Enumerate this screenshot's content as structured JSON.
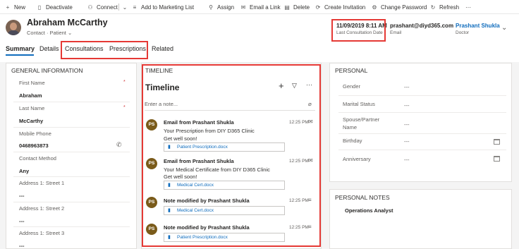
{
  "command_bar": {
    "items": [
      {
        "label": "New",
        "icon": "plus-icon"
      },
      {
        "label": "Deactivate",
        "icon": "deactivate-icon"
      },
      {
        "label": "Connect",
        "icon": "connect-icon"
      },
      {
        "label": "Add to Marketing List",
        "icon": "add-list-icon"
      },
      {
        "label": "Assign",
        "icon": "assign-icon"
      },
      {
        "label": "Email a Link",
        "icon": "email-icon"
      },
      {
        "label": "Delete",
        "icon": "trash-icon"
      },
      {
        "label": "Create Invitation",
        "icon": "invitation-icon"
      },
      {
        "label": "Change Password",
        "icon": "password-icon"
      },
      {
        "label": "Refresh",
        "icon": "refresh-icon"
      }
    ],
    "more": "···"
  },
  "record": {
    "name": "Abraham McCarthy",
    "entity": "Contact",
    "form": "Patient",
    "header_fields": [
      {
        "value": "11/09/2019 8:11 AM",
        "label": "Last Consultation Date"
      },
      {
        "value": "prashant@diyd365.com",
        "label": "Email"
      },
      {
        "value": "Prashant Shukla",
        "label": "Doctor"
      }
    ]
  },
  "tabs": [
    "Summary",
    "Details",
    "Consultations",
    "Prescriptions",
    "Related"
  ],
  "general": {
    "section_title": "GENERAL INFORMATION",
    "fields": [
      {
        "label": "First Name",
        "value": "Abraham",
        "required": "*"
      },
      {
        "label": "Last Name",
        "value": "McCarthy",
        "required": "*"
      },
      {
        "label": "Mobile Phone",
        "value": "0468963873"
      },
      {
        "label": "Contact Method",
        "value": "Any"
      },
      {
        "label": "Address 1: Street 1",
        "value": "---"
      },
      {
        "label": "Address 1: Street 2",
        "value": "---"
      },
      {
        "label": "Address 1: Street 3",
        "value": "---"
      }
    ]
  },
  "timeline": {
    "section_title": "TIMELINE",
    "heading": "Timeline",
    "note_placeholder": "Enter a note...",
    "initials": "PS",
    "items": [
      {
        "title": "Email from Prashant Shukla",
        "lines": [
          "Your Prescription from DIY D365 Clinic",
          "Get well soon!"
        ],
        "time": "12:25 PM",
        "attachment": "Patient Prescription.docx"
      },
      {
        "title": "Email from Prashant Shukla",
        "lines": [
          "Your Medical Certificate from DIY D365 Clinic",
          "Get well soon!"
        ],
        "time": "12:25 PM",
        "attachment": "Medical Cert.docx"
      },
      {
        "title": "Note modified by Prashant Shukla",
        "lines": [],
        "time": "12:25 PM",
        "attachment": "Medical Cert.docx"
      },
      {
        "title": "Note modified by Prashant Shukla",
        "lines": [],
        "time": "12:25 PM",
        "attachment": "Patient Prescription.docx"
      }
    ]
  },
  "personal": {
    "section_title": "PERSONAL",
    "fields": [
      {
        "label": "Gender",
        "value": "---"
      },
      {
        "label": "Marital Status",
        "value": "---"
      },
      {
        "label": "Spouse/Partner Name",
        "value": "---"
      },
      {
        "label": "Birthday",
        "value": "---"
      },
      {
        "label": "Anniversary",
        "value": "---"
      }
    ]
  },
  "personal_notes": {
    "section_title": "PERSONAL NOTES",
    "value": "Operations Analyst"
  },
  "colors": {
    "accent": "#0f6cbd",
    "highlight": "#e53935",
    "avatar": "#7a5b1a"
  }
}
